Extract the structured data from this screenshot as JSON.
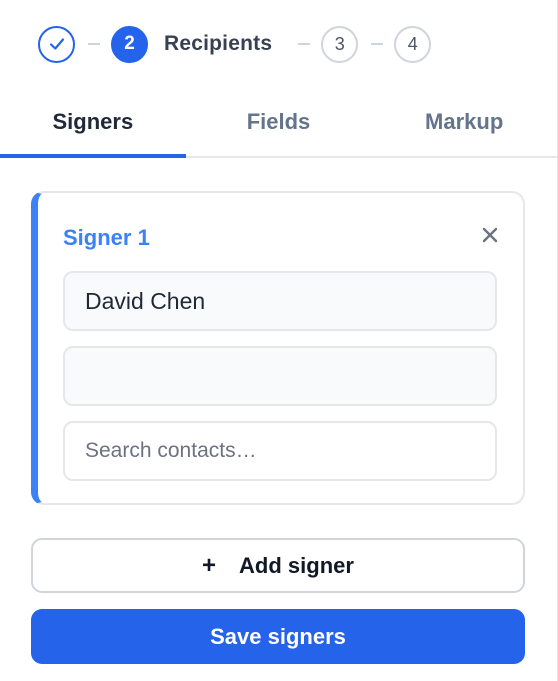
{
  "stepper": {
    "steps": [
      {
        "state": "done",
        "icon": "check-icon"
      },
      {
        "state": "active",
        "number": "2",
        "label": "Recipients"
      },
      {
        "state": "pending",
        "number": "3"
      },
      {
        "state": "pending",
        "number": "4"
      }
    ]
  },
  "tabs": [
    {
      "label": "Signers",
      "active": true
    },
    {
      "label": "Fields",
      "active": false
    },
    {
      "label": "Markup",
      "active": false
    }
  ],
  "signer": {
    "title": "Signer 1",
    "name_value": "David Chen",
    "email_value": "",
    "search_placeholder": "Search contacts…"
  },
  "actions": {
    "add_icon": "+",
    "add_label": "Add signer",
    "save_label": "Save signers"
  },
  "colors": {
    "accent": "#2563eb",
    "signer_accent": "#3b82f6"
  }
}
